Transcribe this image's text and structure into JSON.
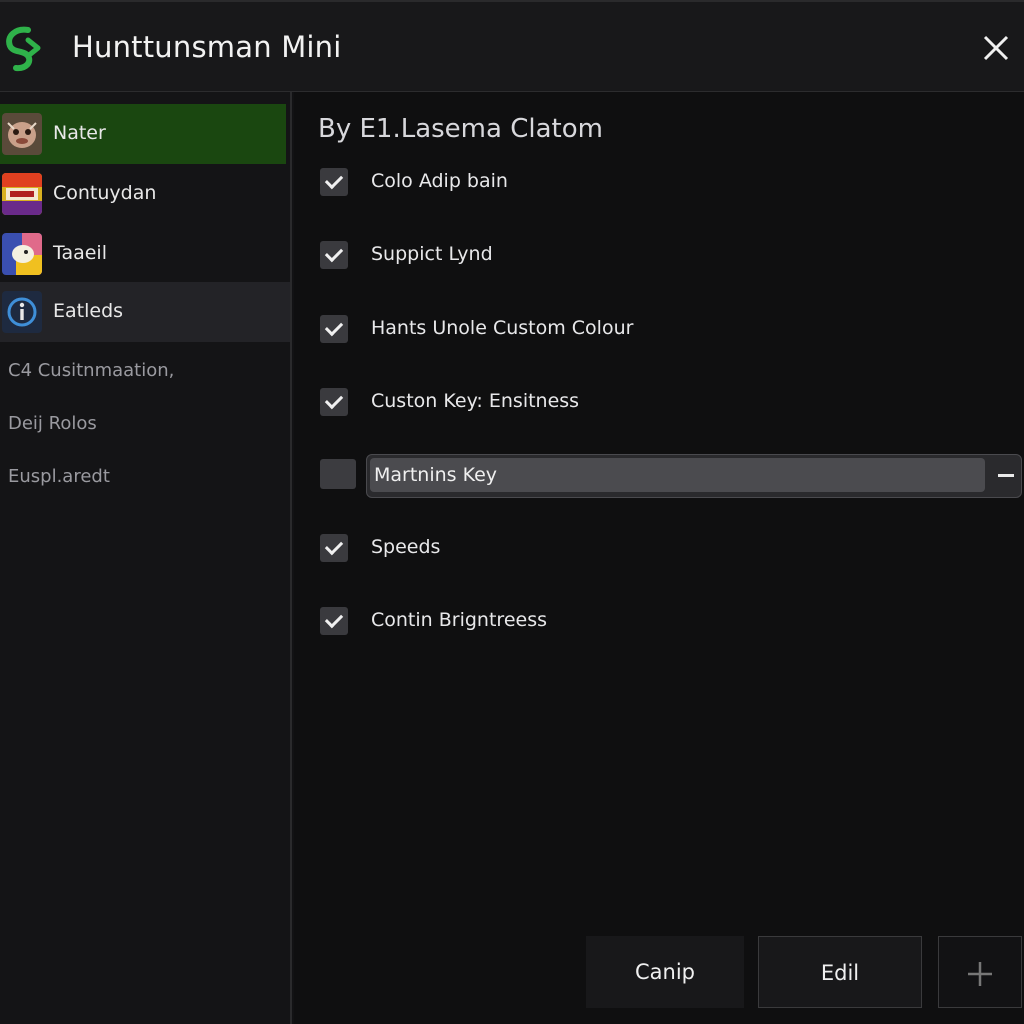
{
  "window": {
    "title": "Hunttunsman Mini"
  },
  "sidebar": {
    "items": [
      {
        "label": "Nater",
        "icon": "creature-avatar-icon",
        "state": "active"
      },
      {
        "label": "Contuydan",
        "icon": "colorful-game-icon",
        "state": "normal"
      },
      {
        "label": "Taaeil",
        "icon": "chat-bubble-icon",
        "state": "normal"
      },
      {
        "label": "Eatleds",
        "icon": "info-icon",
        "state": "hover"
      }
    ],
    "links": [
      {
        "label": "C4 Cusitnmaation,"
      },
      {
        "label": "Deij Rolos"
      },
      {
        "label": "Euspl.aredt"
      }
    ]
  },
  "main": {
    "title": "By E1.Lasema Clatom",
    "options": [
      {
        "label": "Colo Adip bain",
        "checked": true
      },
      {
        "label": "Suppict Lynd",
        "checked": true
      },
      {
        "label": "Hants Unole Custom Colour",
        "checked": true
      },
      {
        "label": "Custon Key: Ensitness",
        "checked": true
      }
    ],
    "key_field": {
      "value": "Martnins Key",
      "checked": false
    },
    "options_after": [
      {
        "label": "Speeds",
        "checked": true
      },
      {
        "label": "Contin Brigntreess",
        "checked": true
      }
    ]
  },
  "footer": {
    "buttons": [
      {
        "label": "Canip"
      },
      {
        "label": "Edil"
      },
      {
        "label": "+",
        "icon": "plus-icon"
      }
    ]
  },
  "colors": {
    "accent": "#1a4710",
    "logo": "#2fb24a",
    "background": "#121214"
  }
}
